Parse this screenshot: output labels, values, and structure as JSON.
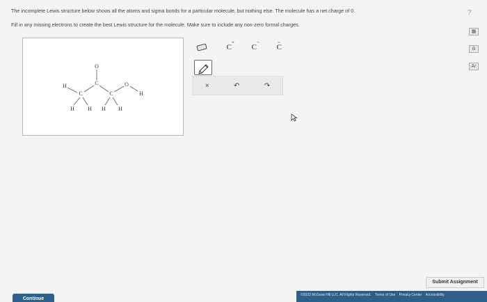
{
  "question": {
    "line1": "The incomplete Lewis structure below shows all the atoms and sigma bonds for a particular molecule, but nothing else. The molecule has a net charge of 0.",
    "line2": "Fill in any missing electrons to create the best Lewis structure for the molecule. Make sure to include any non-zero formal charges."
  },
  "help_label": "?",
  "sidebar_icons": [
    "calculator-icon",
    "chart-icon",
    "periodic-table-icon"
  ],
  "sidebar_icon_glyphs": [
    "▦",
    "ılı",
    "Ar"
  ],
  "molecule": {
    "atoms": {
      "o_top": "O",
      "h_left": "H",
      "c1": "C",
      "c2": "C",
      "c3": "C",
      "o_right": "O",
      "h_right": "H",
      "h_b1": "H",
      "h_b2": "H",
      "h_b3": "H",
      "h_b4": "H"
    }
  },
  "toolbar": {
    "carbocation_letter": "C",
    "carbocation_sup": "+",
    "carbanion_letter": "C",
    "carbanion_sup": "−",
    "lone_pair_letter": "C",
    "lone_pair_dots": "··"
  },
  "actions": {
    "clear": "×",
    "undo": "↶",
    "redo": "↷"
  },
  "submit_label": "Submit Assignment",
  "footer": {
    "copyright": "©2022 McGraw Hill LLC. All Rights Reserved.",
    "terms": "Terms of Use",
    "privacy": "Privacy Center",
    "accessibility": "Accessibility"
  },
  "continue_label": "Continue"
}
